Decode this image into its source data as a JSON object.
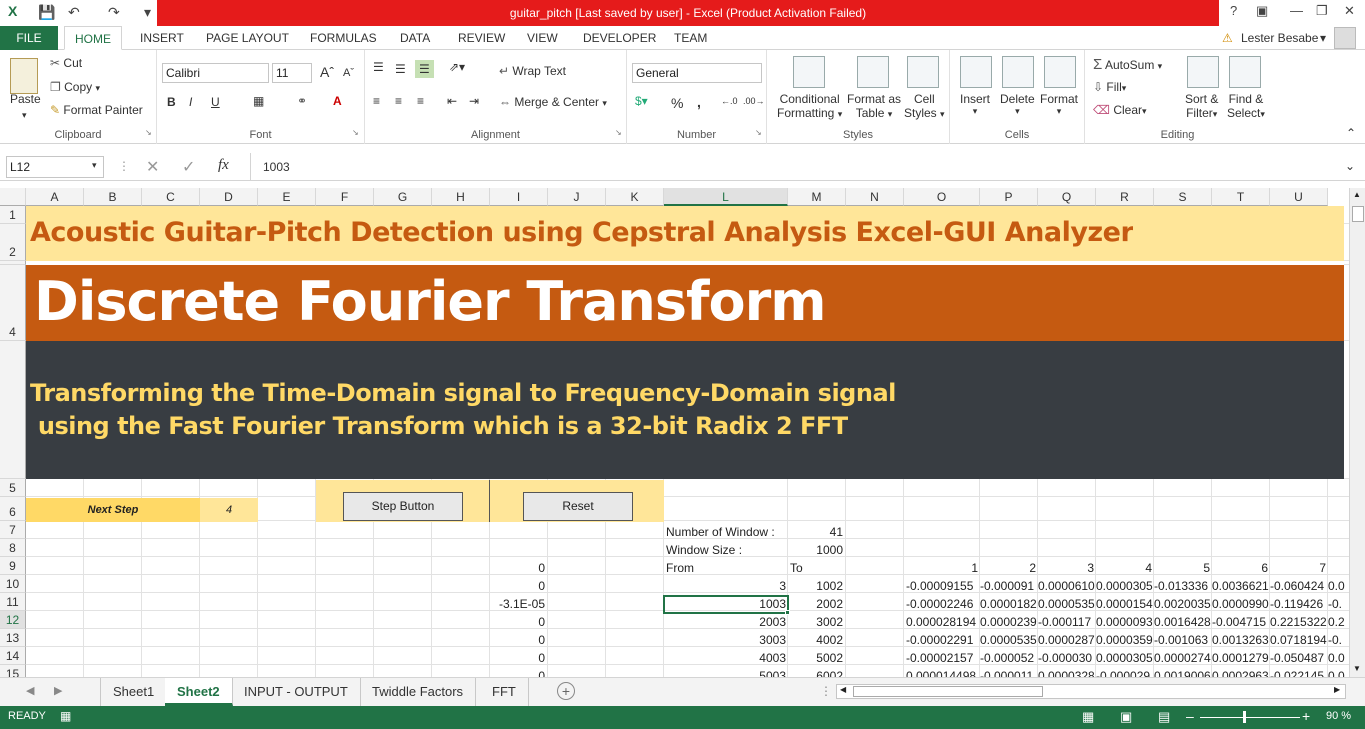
{
  "window": {
    "title": "guitar_pitch [Last saved by user] -  Excel (Product Activation Failed)",
    "help": "?",
    "user": "Lester Besabe"
  },
  "ribbon_tabs": [
    "HOME",
    "INSERT",
    "PAGE LAYOUT",
    "FORMULAS",
    "DATA",
    "REVIEW",
    "VIEW",
    "DEVELOPER",
    "TEAM"
  ],
  "file_tab": "FILE",
  "clipboard": {
    "paste": "Paste",
    "cut": "Cut",
    "copy": "Copy",
    "format_painter": "Format Painter",
    "label": "Clipboard"
  },
  "font": {
    "name": "Calibri",
    "size": "11",
    "label": "Font",
    "bold": "B",
    "italic": "I",
    "underline": "U"
  },
  "alignment": {
    "wrap": "Wrap Text",
    "merge": "Merge & Center",
    "label": "Alignment"
  },
  "number": {
    "format": "General",
    "percent": "%",
    "comma": ",",
    "label": "Number"
  },
  "styles": {
    "conditional": [
      "Conditional",
      "Formatting"
    ],
    "format_table": [
      "Format as",
      "Table"
    ],
    "cell_styles": [
      "Cell",
      "Styles"
    ],
    "label": "Styles"
  },
  "cells": {
    "insert": "Insert",
    "delete": "Delete",
    "format": "Format",
    "label": "Cells"
  },
  "editing": {
    "autosum": "AutoSum",
    "fill": "Fill",
    "clear": "Clear",
    "sort": [
      "Sort &",
      "Filter"
    ],
    "find": [
      "Find &",
      "Select"
    ],
    "label": "Editing"
  },
  "formula_bar": {
    "name_box": "L12",
    "fx": "fx",
    "content": "1003"
  },
  "columns": [
    "A",
    "B",
    "C",
    "D",
    "E",
    "F",
    "G",
    "H",
    "I",
    "J",
    "K",
    "L",
    "M",
    "N",
    "O",
    "P",
    "Q",
    "R",
    "S",
    "T",
    "U"
  ],
  "rows": [
    "1",
    "2",
    "",
    "4",
    "",
    "5",
    "6",
    "7",
    "8",
    "9",
    "10",
    "11",
    "12",
    "13",
    "14",
    "15",
    "16"
  ],
  "sheet": {
    "banner1": "Acoustic Guitar-Pitch Detection using Cepstral Analysis Excel-GUI Analyzer",
    "banner2": "Discrete Fourier Transform",
    "banner3_line1": "Transforming the Time-Domain signal to Frequency-Domain signal",
    "banner3_line2": " using the Fast Fourier Transform which is a 32-bit Radix 2 FFT",
    "next_step_label": "Next Step",
    "next_step_value": "4",
    "step_button": "Step Button",
    "reset_button": "Reset",
    "num_window_label": "Number of Window :",
    "num_window_value": "41",
    "window_size_label": "Window Size :",
    "window_size_value": "1000",
    "from_label": "From",
    "to_label": "To",
    "col_i": [
      "0",
      "0",
      "-3.1E-05",
      "0",
      "0",
      "0",
      "0"
    ],
    "from_vals": [
      "3",
      "1003",
      "2003",
      "3003",
      "4003",
      "5003"
    ],
    "to_vals": [
      "1002",
      "2002",
      "3002",
      "4002",
      "5002",
      "6002"
    ],
    "idx_headers": [
      "1",
      "2",
      "3",
      "4",
      "5",
      "6",
      "7"
    ],
    "data_rows": [
      [
        "-0.00009155",
        "-0.000091",
        "0.0000610",
        "0.0000305",
        "-0.013336",
        "0.0036621",
        "-0.060424",
        "0.0"
      ],
      [
        "-0.00002246",
        "0.0000182",
        "0.0000535",
        "0.0000154",
        "0.0020035",
        "0.0000990",
        "-0.119426",
        "-0."
      ],
      [
        "0.000028194",
        "0.0000239",
        "-0.000117",
        "0.0000093",
        "0.0016428",
        "-0.004715",
        "0.2215322",
        "0.2"
      ],
      [
        "-0.00002291",
        "0.0000535",
        "0.0000287",
        "0.0000359",
        "-0.001063",
        "0.0013263",
        "0.0718194",
        "-0."
      ],
      [
        "-0.00002157",
        "-0.000052",
        "-0.000030",
        "0.0000305",
        "0.0000274",
        "0.0001279",
        "-0.050487",
        "0.0"
      ],
      [
        "0.000014498",
        "-0.000011",
        "0.0000328",
        "-0.000029",
        "0.0019006",
        "0.0002963",
        "-0.022145",
        "0.0"
      ]
    ]
  },
  "sheet_tabs": [
    "Sheet1",
    "Sheet2",
    "INPUT - OUTPUT",
    "Twiddle Factors",
    "FFT"
  ],
  "status": {
    "ready": "READY",
    "zoom": "90 %"
  },
  "colors": {
    "excel_green": "#217346",
    "title_red": "#e51b1b",
    "banner_yellow": "#ffe699",
    "banner_orange": "#c55a11",
    "banner_dark": "#383d42",
    "text_orange": "#c55a11",
    "text_yellow": "#ffd966",
    "next_step_bg": "#ffd966"
  }
}
